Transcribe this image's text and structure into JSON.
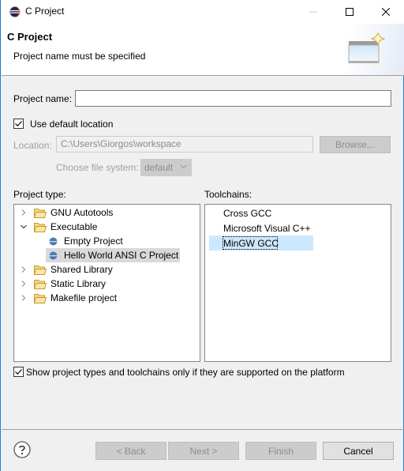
{
  "window": {
    "title": "C Project",
    "controls": [
      "minimize",
      "maximize",
      "close"
    ]
  },
  "banner": {
    "title": "C Project",
    "message": "Project name must be specified",
    "icon": "new-project-wizard-icon"
  },
  "form": {
    "project_name_label": "Project name:",
    "project_name_value": "",
    "use_default_location_label": "Use default location",
    "use_default_location_checked": true,
    "location_label": "Location:",
    "location_value": "C:\\Users\\Giorgos\\workspace",
    "browse_label": "Browse...",
    "file_system_label": "Choose file system:",
    "file_system_value": "default"
  },
  "project_type": {
    "label": "Project type:",
    "items": [
      {
        "label": "GNU Autotools",
        "kind": "folder",
        "expanded": false,
        "level": 0
      },
      {
        "label": "Executable",
        "kind": "folder",
        "expanded": true,
        "level": 0
      },
      {
        "label": "Empty Project",
        "kind": "project",
        "level": 1
      },
      {
        "label": "Hello World ANSI C Project",
        "kind": "project",
        "level": 1,
        "selected": true
      },
      {
        "label": "Shared Library",
        "kind": "folder",
        "expanded": false,
        "level": 0
      },
      {
        "label": "Static Library",
        "kind": "folder",
        "expanded": false,
        "level": 0
      },
      {
        "label": "Makefile project",
        "kind": "folder",
        "expanded": false,
        "level": 0
      }
    ]
  },
  "toolchains": {
    "label": "Toolchains:",
    "items": [
      "Cross GCC",
      "Microsoft Visual C++",
      "MinGW GCC"
    ],
    "selected": "MinGW GCC"
  },
  "filter": {
    "label": "Show project types and toolchains only if they are supported on the platform",
    "checked": true
  },
  "buttons": {
    "back": "< Back",
    "next": "Next >",
    "finish": "Finish",
    "cancel": "Cancel"
  },
  "colors": {
    "window_border": "#1883d7",
    "selection": "#cce8ff",
    "inactive_selection": "#d9d9d9"
  }
}
